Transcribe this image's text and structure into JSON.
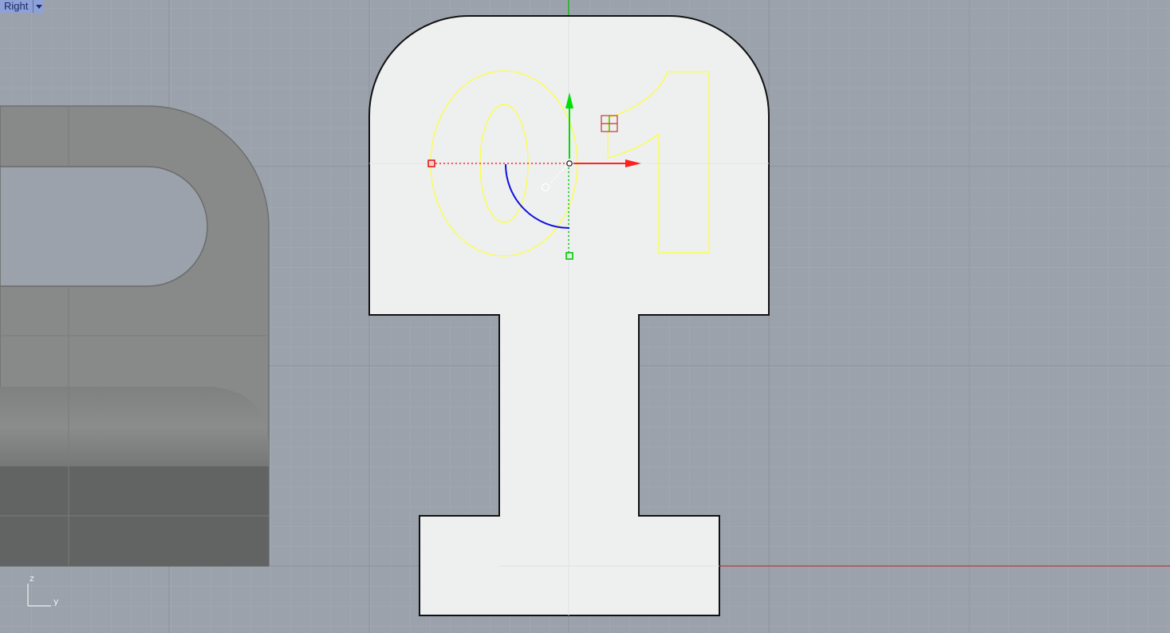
{
  "viewport": {
    "title": "Right",
    "menu_icon": "chevron-down-icon",
    "background_color": "#9ba2ab",
    "object_fill_color": "#eef0f0",
    "curve_color": "#ffff00"
  },
  "embossed_text": "01",
  "axis_indicator": {
    "vertical_label": "z",
    "horizontal_label": "y"
  },
  "gumball": {
    "x_axis_color": "#ff2020",
    "y_axis_color": "#00e000",
    "rotation_color": "#1010e0"
  }
}
